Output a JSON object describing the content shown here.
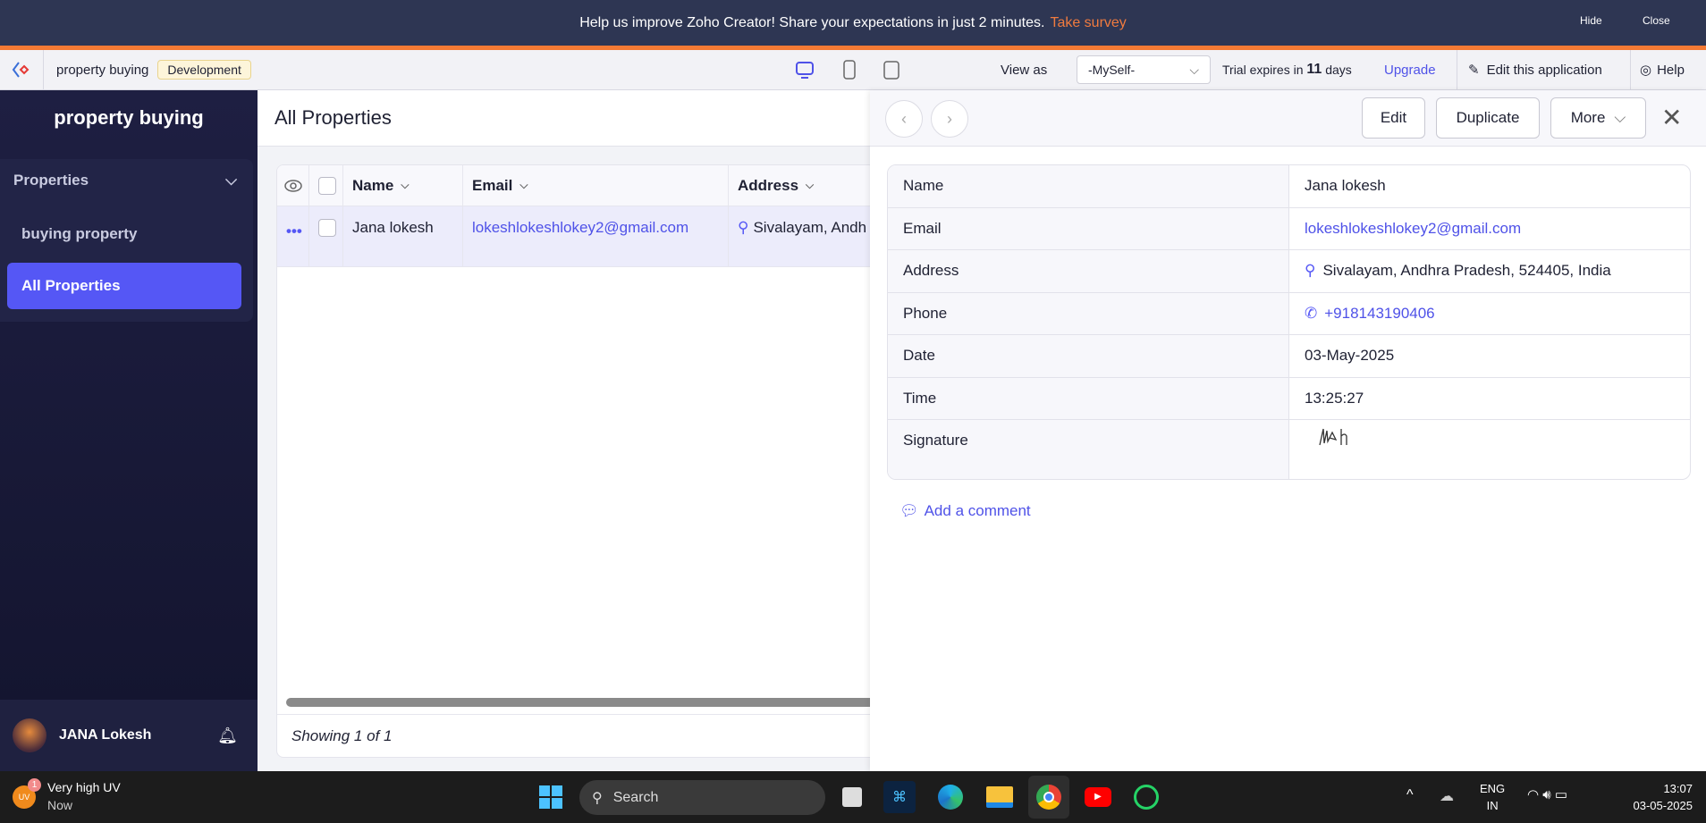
{
  "banner": {
    "message": "Help us improve Zoho Creator! Share your expectations in just 2 minutes.",
    "survey_link": "Take survey",
    "hide": "Hide",
    "close": "Close"
  },
  "toolbar": {
    "app_name": "property buying",
    "environment": "Development",
    "view_as_label": "View as",
    "view_as_value": "-MySelf-",
    "trial_prefix": "Trial expires in",
    "trial_days": "11",
    "trial_suffix": "days",
    "upgrade": "Upgrade",
    "edit_app": "Edit this application",
    "help": "Help"
  },
  "sidebar": {
    "title": "property buying",
    "group": "Properties",
    "items": [
      {
        "label": "buying property"
      },
      {
        "label": "All Properties",
        "active": true
      }
    ],
    "user": "JANA Lokesh"
  },
  "main": {
    "title": "All Properties",
    "columns": [
      "Name",
      "Email",
      "Address"
    ],
    "rows": [
      {
        "name": "Jana lokesh",
        "email": "lokeshlokeshlokey2@gmail.com",
        "address": "Sivalayam, Andh"
      }
    ],
    "footer": "Showing 1 of 1"
  },
  "panel": {
    "edit": "Edit",
    "duplicate": "Duplicate",
    "more": "More",
    "fields": [
      {
        "label": "Name",
        "value": "Jana lokesh"
      },
      {
        "label": "Email",
        "value": "lokeshlokeshlokey2@gmail.com"
      },
      {
        "label": "Address",
        "value": "Sivalayam, Andhra Pradesh, 524405, India"
      },
      {
        "label": "Phone",
        "value": "+918143190406"
      },
      {
        "label": "Date",
        "value": "03-May-2025"
      },
      {
        "label": "Time",
        "value": "13:25:27"
      },
      {
        "label": "Signature",
        "value": ""
      }
    ],
    "add_comment": "Add a comment"
  },
  "taskbar": {
    "weather_title": "Very high UV",
    "weather_sub": "Now",
    "weather_badge": "1",
    "weather_icon": "UV",
    "search": "Search",
    "lang": "ENG",
    "region": "IN",
    "time": "13:07",
    "date": "03-05-2025"
  },
  "colors": {
    "accent": "#5557f5",
    "banner": "#2e3653",
    "orange": "#f47a34",
    "link": "#4f52e8"
  }
}
